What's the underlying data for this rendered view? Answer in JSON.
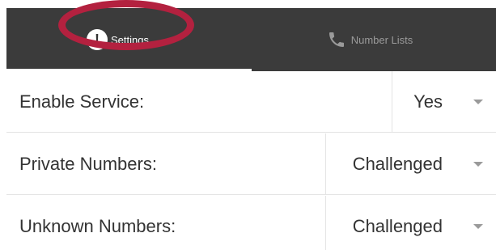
{
  "tabs": {
    "settings_label": "Settings",
    "number_lists_label": "Number Lists",
    "alert_glyph": "!"
  },
  "rows": [
    {
      "label": "Enable Service:",
      "value": "Yes"
    },
    {
      "label": "Private Numbers:",
      "value": "Challenged"
    },
    {
      "label": "Unknown Numbers:",
      "value": "Challenged"
    }
  ],
  "colors": {
    "tabbar_bg": "#3b3b3b",
    "highlight_ring": "#b3213f",
    "text": "#333333",
    "divider": "#e4e4e4"
  },
  "icons": {
    "settings_tab": "alert-circle-icon",
    "number_lists_tab": "phone-icon",
    "select_caret": "caret-down-icon"
  }
}
